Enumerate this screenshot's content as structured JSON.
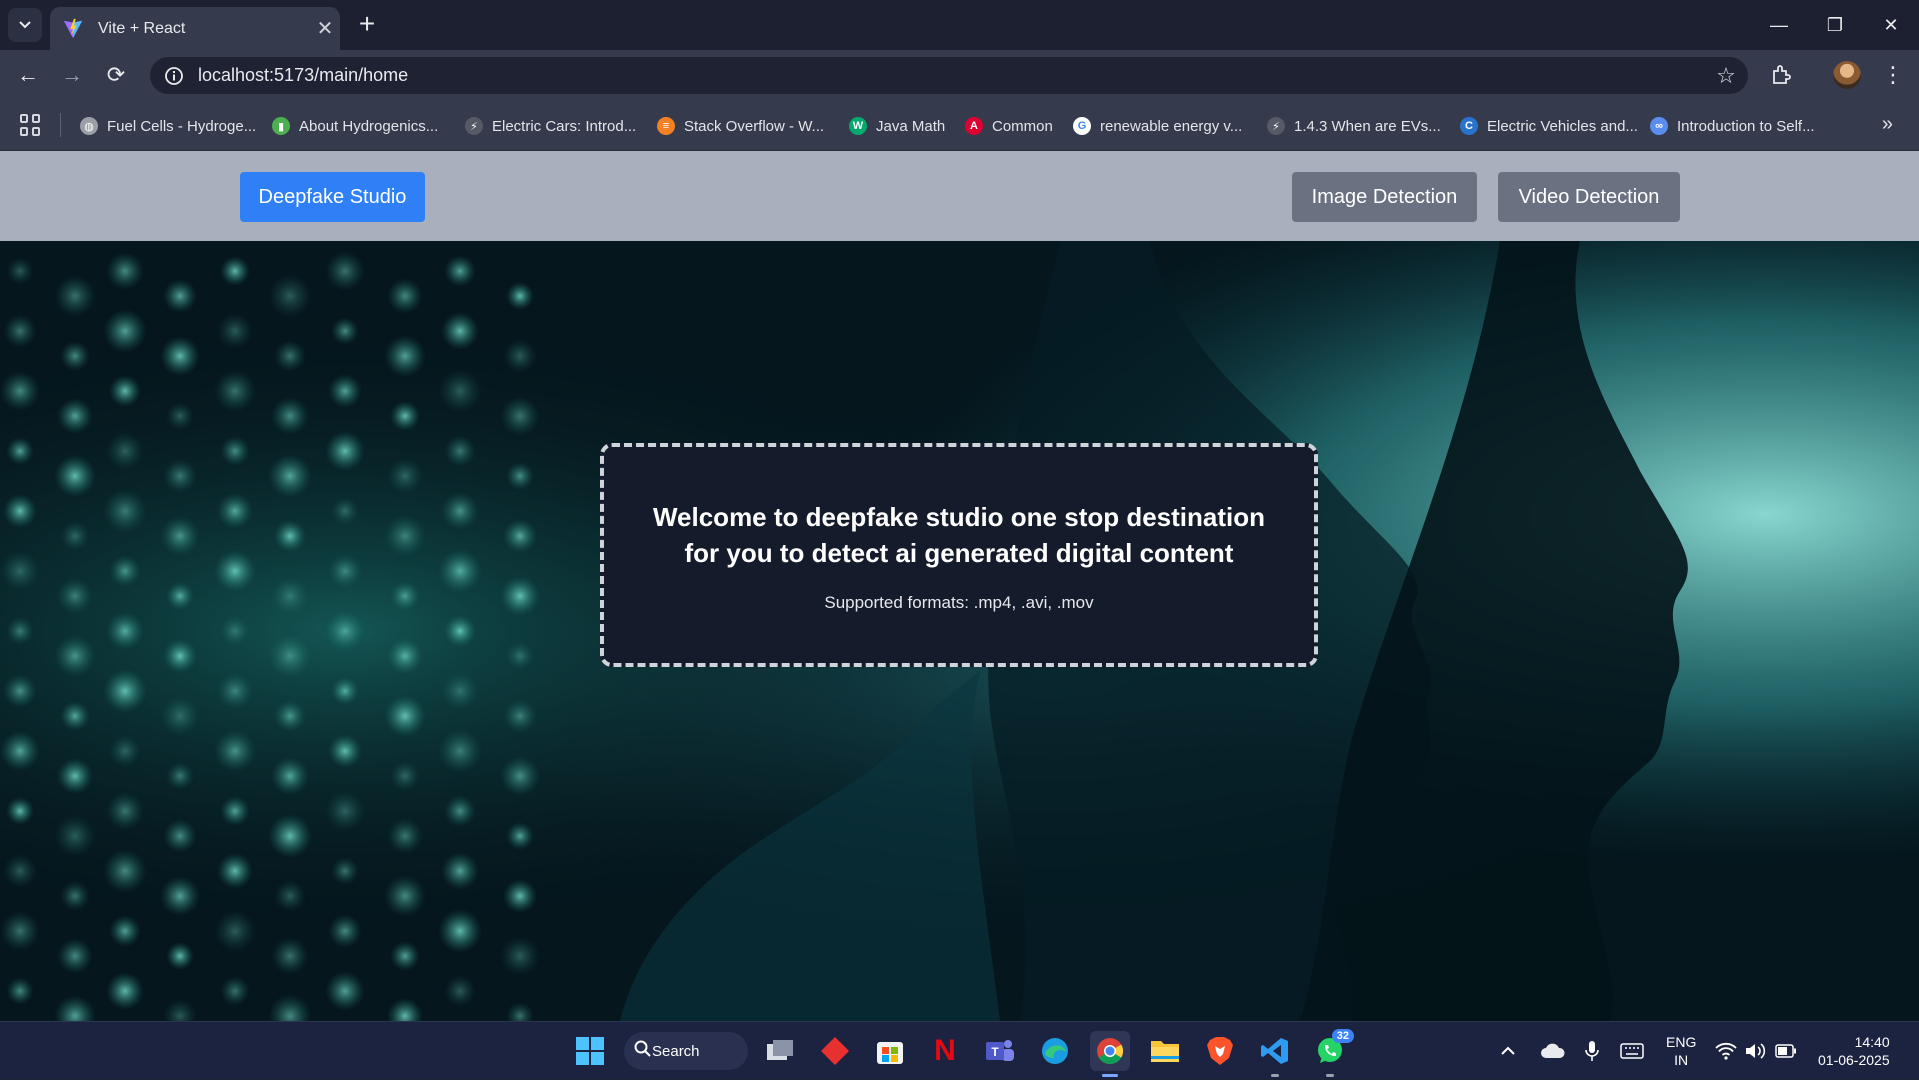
{
  "browser": {
    "tab_title": "Vite + React",
    "url": "localhost:5173/main/home",
    "bookmarks": [
      {
        "label": "Fuel Cells - Hydroge...",
        "icon": "globe-icon",
        "color": "#9aa0a6"
      },
      {
        "label": "About Hydrogenics...",
        "icon": "hydrogenics-icon",
        "color": "#4caf50"
      },
      {
        "label": "Electric Cars: Introd...",
        "icon": "lightning-icon",
        "color": "#555a66"
      },
      {
        "label": "Stack Overflow - W...",
        "icon": "stackoverflow-icon",
        "color": "#f48024"
      },
      {
        "label": "Java Math",
        "icon": "w3-icon",
        "color": "#04aa6d"
      },
      {
        "label": "Common",
        "icon": "angular-icon",
        "color": "#dd0031"
      },
      {
        "label": "renewable energy v...",
        "icon": "google-icon",
        "color": "#ffffff"
      },
      {
        "label": "1.4.3 When are EVs...",
        "icon": "lightning-icon",
        "color": "#555a66"
      },
      {
        "label": "Electric Vehicles and...",
        "icon": "coursera-icon",
        "color": "#2a73cc"
      },
      {
        "label": "Introduction to Self...",
        "icon": "infinity-icon",
        "color": "#5b8def"
      }
    ]
  },
  "navbar": {
    "brand": "Deepfake Studio",
    "links": [
      "Image Detection",
      "Video Detection"
    ]
  },
  "hero": {
    "title": "Welcome to deepfake studio one stop destination for you to detect ai generated digital content",
    "subtitle": "Supported formats: .mp4, .avi, .mov"
  },
  "taskbar": {
    "search_label": "Search",
    "whatsapp_badge": "32",
    "language": "ENG",
    "region": "IN",
    "time": "14:40",
    "date": "01-06-2025"
  },
  "colors": {
    "brand_button": "#2f80f7",
    "nav_button": "#6a7180",
    "navbar_bg": "#a8b0be",
    "card_bg": "#141b2b"
  }
}
